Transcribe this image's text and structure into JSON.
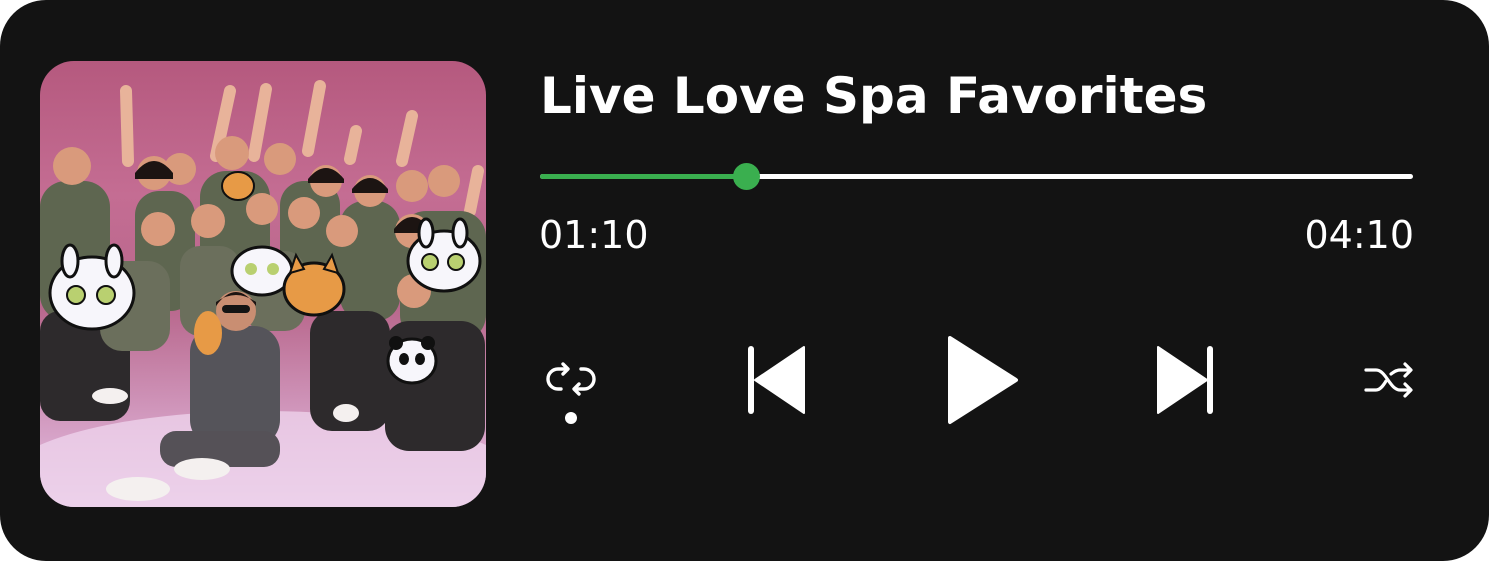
{
  "player": {
    "title": "Live Love Spa Favorites",
    "progress_fraction": 0.236,
    "elapsed_time": "01:10",
    "total_time": "04:10",
    "repeat_enabled": true
  },
  "controls": {
    "repeat_icon": "repeat-icon",
    "previous_icon": "skip-previous-icon",
    "play_icon": "play-icon",
    "next_icon": "skip-next-icon",
    "shuffle_icon": "shuffle-icon"
  },
  "colors": {
    "background": "#131313",
    "accent": "#3aaf4f",
    "foreground": "#ffffff"
  }
}
